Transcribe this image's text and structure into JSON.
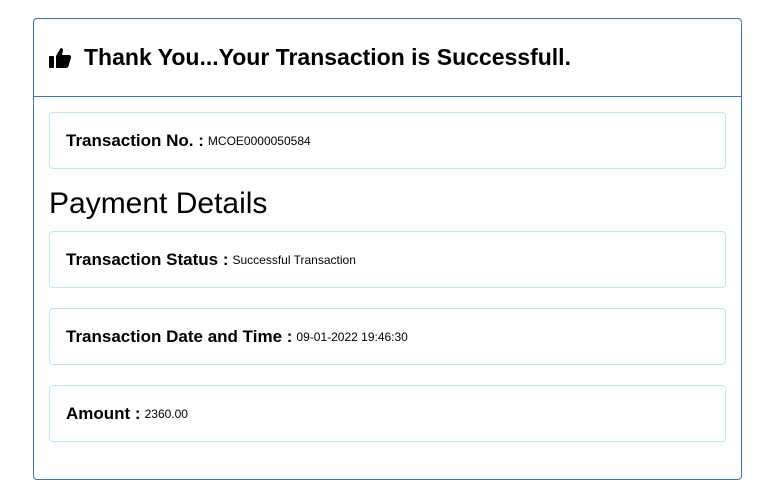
{
  "header": {
    "icon": "thumbs-up-icon",
    "title": "Thank You...Your Transaction is Successfull."
  },
  "transaction": {
    "number_label": "Transaction No. :",
    "number_value": "MCOE0000050584"
  },
  "payment_details": {
    "title": "Payment Details",
    "status_label": "Transaction Status :",
    "status_value": "Successful Transaction",
    "datetime_label": "Transaction Date and Time :",
    "datetime_value": "09-01-2022 19:46:30",
    "amount_label": "Amount :",
    "amount_value": "2360.00"
  }
}
